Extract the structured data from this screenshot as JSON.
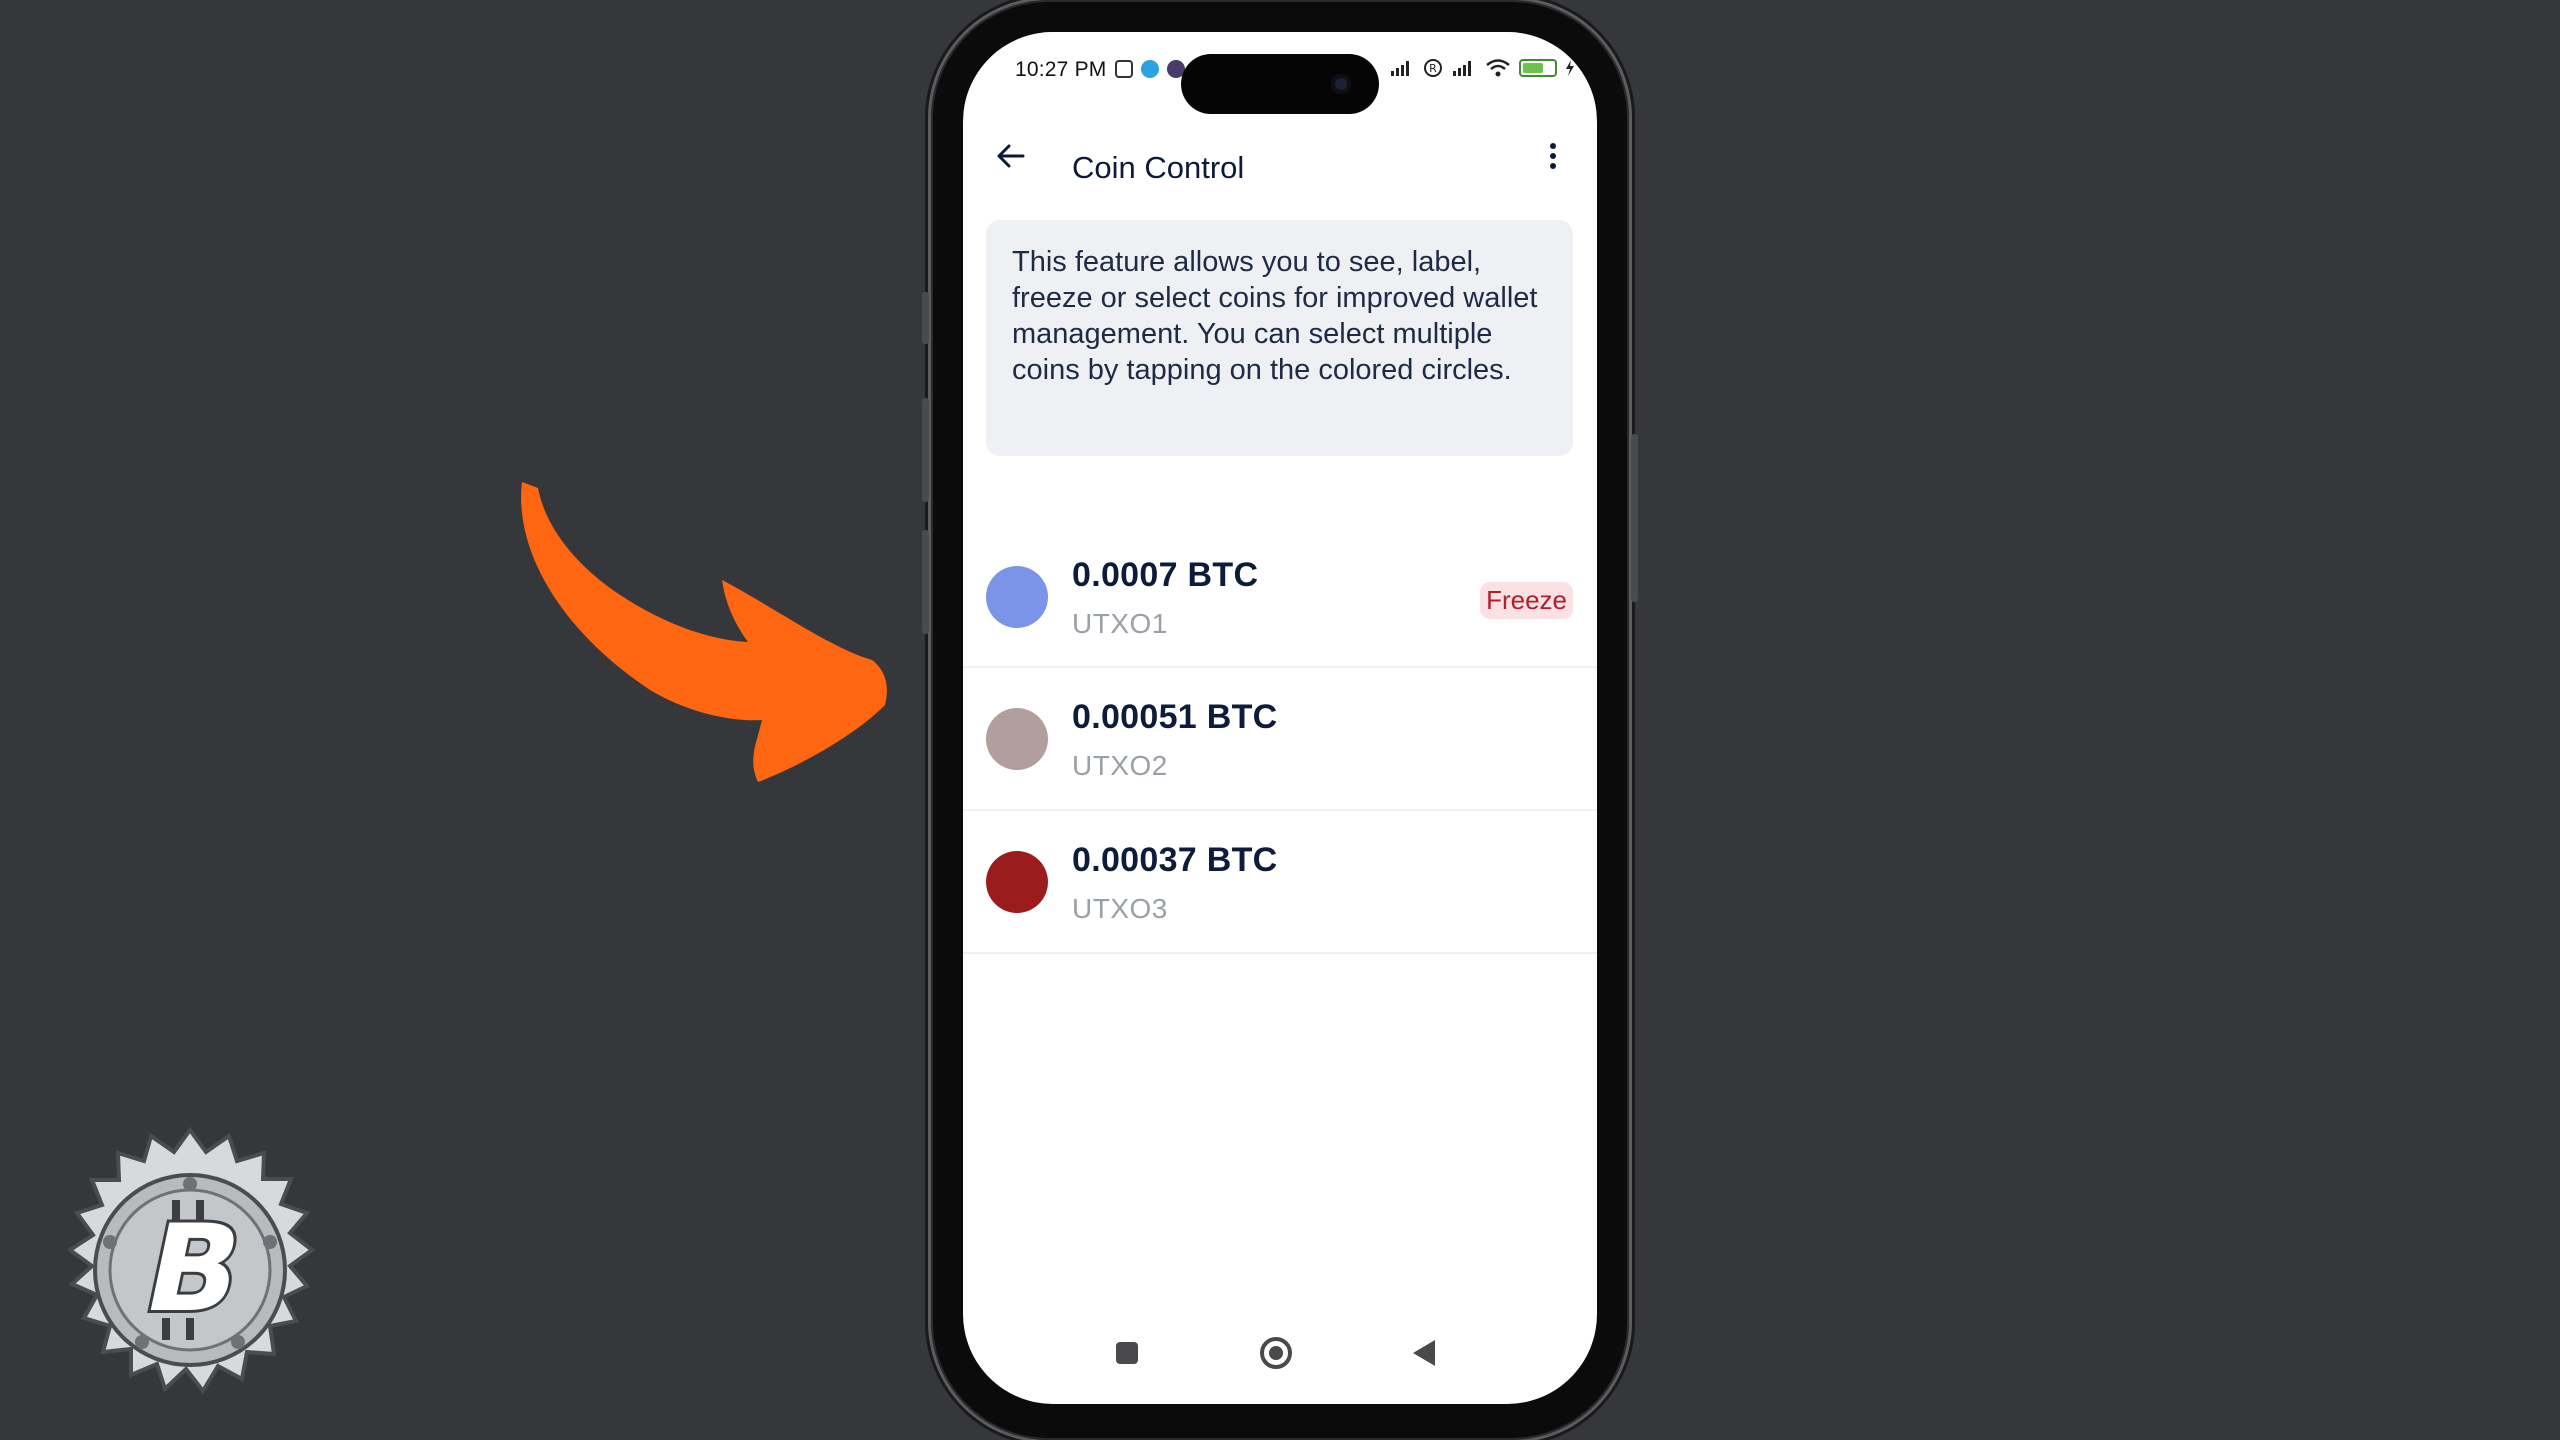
{
  "status_bar": {
    "time": "10:27 PM",
    "battery_level": "61"
  },
  "app_bar": {
    "title": "Coin Control",
    "back_icon": "arrow-left-icon",
    "menu_icon": "more-vert-icon"
  },
  "info": {
    "text": "This feature allows you to see, label, freeze or select coins for improved wallet management. You can select multiple coins by tapping on the colored circles."
  },
  "coins": [
    {
      "amount": "0.0007 BTC",
      "label": "UTXO1",
      "color": "#7b94e8",
      "badge": "Freeze"
    },
    {
      "amount": "0.00051 BTC",
      "label": "UTXO2",
      "color": "#b29e9f",
      "badge": ""
    },
    {
      "amount": "0.00037 BTC",
      "label": "UTXO3",
      "color": "#9c1b1c",
      "badge": ""
    }
  ],
  "nav": {
    "recents_icon": "square-icon",
    "home_icon": "circle-icon",
    "back_icon": "triangle-back-icon"
  },
  "overlay": {
    "arrow_color": "#ff6611",
    "logo_icon": "bitcoin-gear-badge-icon"
  }
}
